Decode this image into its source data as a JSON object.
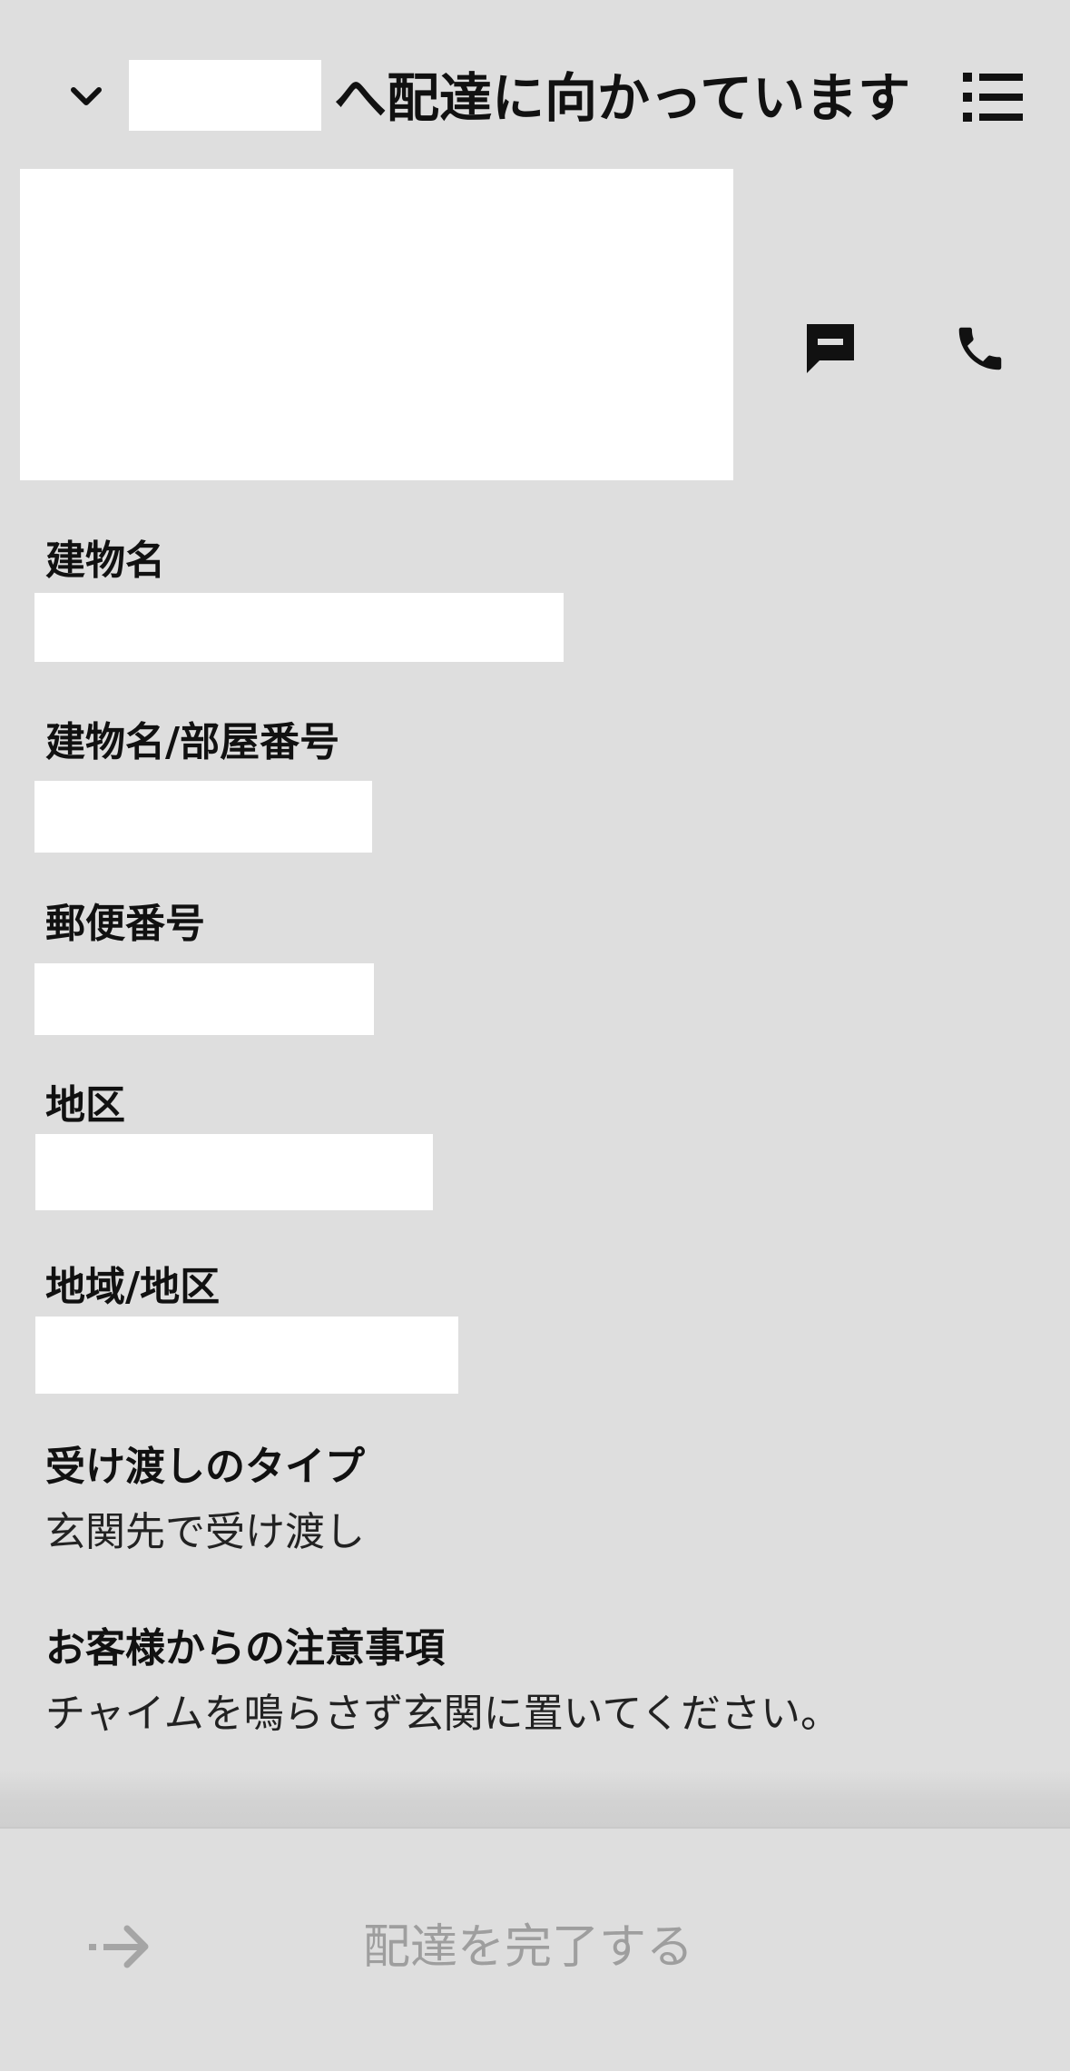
{
  "header": {
    "title_suffix": "へ配達に向かっています",
    "collapse_icon": "chevron-down-icon",
    "menu_icon": "list-menu-icon"
  },
  "actions": {
    "message_icon": "message-icon",
    "call_icon": "phone-icon"
  },
  "fields": [
    {
      "label": "建物名"
    },
    {
      "label": "建物名/部屋番号"
    },
    {
      "label": "郵便番号"
    },
    {
      "label": "地区"
    },
    {
      "label": "地域/地区"
    }
  ],
  "handoff": {
    "label": "受け渡しのタイプ",
    "value": "玄関先で受け渡し"
  },
  "notes": {
    "label": "お客様からの注意事項",
    "value": "チャイムを鳴らさず玄関に置いてください。"
  },
  "footer": {
    "complete_label": "配達を完了する",
    "arrow_icon": "arrow-right-icon"
  },
  "colors": {
    "background": "#dedede",
    "redaction": "#ffffff",
    "text": "#111111",
    "disabled_text": "#9e9e9e"
  }
}
